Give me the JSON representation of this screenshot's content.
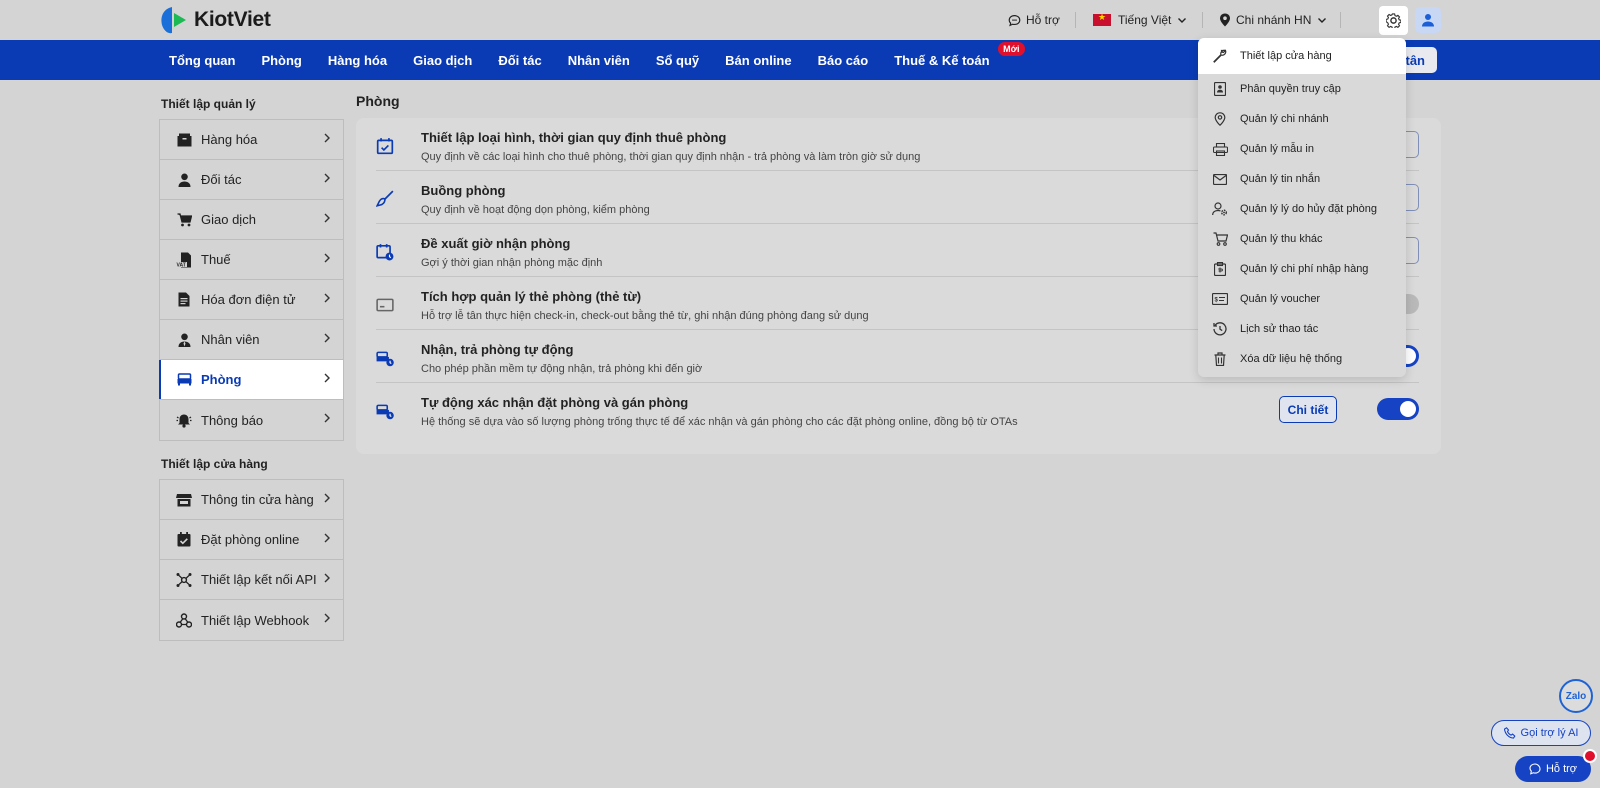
{
  "brand": {
    "name": "KiotViet"
  },
  "topbar": {
    "support": "Hỗ trợ",
    "language": "Tiếng Việt",
    "branch": "Chi nhánh HN"
  },
  "nav": {
    "items": [
      "Tổng quan",
      "Phòng",
      "Hàng hóa",
      "Giao dịch",
      "Đối tác",
      "Nhân viên",
      "Sổ quỹ",
      "Bán online",
      "Báo cáo",
      "Thuế & Kế toán"
    ],
    "new_badge": "Mới",
    "right_button_partial": "tân"
  },
  "sidebar": {
    "group1_title": "Thiết lập quản lý",
    "group1": [
      {
        "label": "Hàng hóa",
        "icon": "box-icon"
      },
      {
        "label": "Đối tác",
        "icon": "person-icon"
      },
      {
        "label": "Giao dịch",
        "icon": "cart-icon"
      },
      {
        "label": "Thuế",
        "icon": "vat-icon"
      },
      {
        "label": "Hóa đơn điện tử",
        "icon": "invoice-icon"
      },
      {
        "label": "Nhân viên",
        "icon": "employee-icon"
      },
      {
        "label": "Phòng",
        "icon": "bed-icon",
        "active": true
      },
      {
        "label": "Thông báo",
        "icon": "bell-icon"
      }
    ],
    "group2_title": "Thiết lập cửa hàng",
    "group2": [
      {
        "label": "Thông tin cửa hàng",
        "icon": "store-icon"
      },
      {
        "label": "Đặt phòng online",
        "icon": "calendar-check-icon"
      },
      {
        "label": "Thiết lập kết nối API",
        "icon": "api-icon"
      },
      {
        "label": "Thiết lập Webhook",
        "icon": "webhook-icon"
      }
    ]
  },
  "main": {
    "title": "Phòng",
    "rows": [
      {
        "title": "Thiết lập loại hình, thời gian quy định thuê phòng",
        "desc": "Quy định về các loại hình cho thuê phòng, thời gian quy định nhận - trả phòng và làm tròn giờ sử dụng",
        "control": "partial-button"
      },
      {
        "title": "Buồng phòng",
        "desc": "Quy định về hoạt động dọn phòng, kiểm phòng",
        "control": "partial-button"
      },
      {
        "title": "Đề xuất giờ nhận phòng",
        "desc": "Gợi ý thời gian nhận phòng mặc định",
        "control": "partial-button"
      },
      {
        "title": "Tích hợp quản lý thẻ phòng (thẻ từ)",
        "desc": "Hỗ trợ lễ tân thực hiện check-in, check-out bằng thẻ từ, ghi nhận đúng phòng đang sử dụng",
        "control": "toggle-off"
      },
      {
        "title": "Nhận, trả phòng tự động",
        "desc": "Cho phép phần mềm tự động nhận, trả phòng khi đến giờ",
        "control": "toggle-on"
      },
      {
        "title": "Tự động xác nhận đặt phòng và gán phòng",
        "desc": "Hệ thống sẽ dựa vào số lượng phòng trống thực tế để xác nhận và gán phòng cho các đặt phòng online, đồng bộ từ OTAs",
        "control": "detail-toggle"
      }
    ],
    "detail_label": "Chi tiết"
  },
  "dropdown": {
    "items": [
      {
        "label": "Thiết lập cửa hàng",
        "icon": "wrench-icon"
      },
      {
        "label": "Phân quyền truy cập",
        "icon": "permission-icon"
      },
      {
        "label": "Quản lý chi nhánh",
        "icon": "location-icon"
      },
      {
        "label": "Quản lý mẫu in",
        "icon": "printer-icon"
      },
      {
        "label": "Quản lý tin nhắn",
        "icon": "mail-icon"
      },
      {
        "label": "Quản lý lý do hủy đặt phòng",
        "icon": "user-gear-icon"
      },
      {
        "label": "Quản lý thu khác",
        "icon": "cart-icon"
      },
      {
        "label": "Quản lý chi phí nhập hàng",
        "icon": "cost-icon"
      },
      {
        "label": "Quản lý voucher",
        "icon": "voucher-icon"
      },
      {
        "label": "Lịch sử thao tác",
        "icon": "history-icon"
      },
      {
        "label": "Xóa dữ liệu hệ thống",
        "icon": "trash-icon"
      }
    ]
  },
  "floating": {
    "zalo": "Zalo",
    "ai": "Gọi trợ lý AI",
    "help": "Hỗ trợ"
  },
  "colors": {
    "primary": "#0a3bb5",
    "badge": "#e0102c"
  }
}
